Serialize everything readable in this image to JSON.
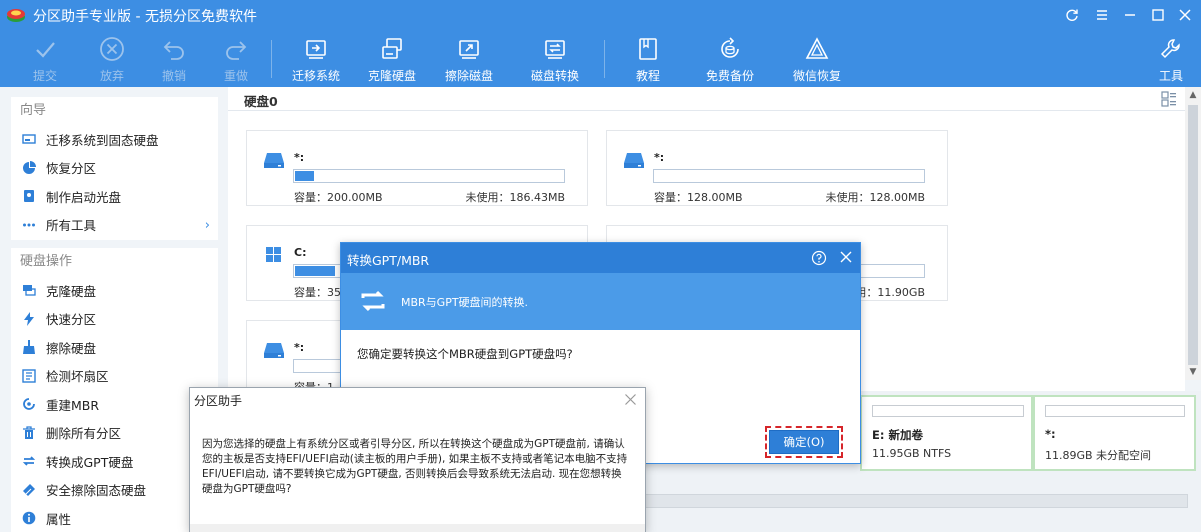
{
  "app": {
    "title": "分区助手专业版 - 无损分区免费软件"
  },
  "window_controls": [
    "refresh-icon",
    "menu-icon",
    "minimize-icon",
    "maximize-icon",
    "close-icon"
  ],
  "toolbar": {
    "submit": "提交",
    "discard": "放弃",
    "undo": "撤销",
    "redo": "重做",
    "migrate": "迁移系统",
    "clone": "克隆硬盘",
    "wipe": "擦除磁盘",
    "convert": "磁盘转换",
    "tutorial": "教程",
    "backup": "免费备份",
    "wechat": "微信恢复",
    "tools": "工具"
  },
  "sidebar": {
    "guide_heading": "向导",
    "guide_items": [
      {
        "label": "迁移系统到固态硬盘",
        "icon": "migrate-ssd-icon"
      },
      {
        "label": "恢复分区",
        "icon": "recover-partition-icon"
      },
      {
        "label": "制作启动光盘",
        "icon": "boot-disc-icon"
      },
      {
        "label": "所有工具",
        "icon": "more-icon"
      }
    ],
    "disk_heading": "硬盘操作",
    "disk_items": [
      {
        "label": "克隆硬盘",
        "icon": "clone-disk-icon"
      },
      {
        "label": "快速分区",
        "icon": "lightning-icon"
      },
      {
        "label": "擦除硬盘",
        "icon": "brush-icon"
      },
      {
        "label": "检测坏扇区",
        "icon": "check-sector-icon"
      },
      {
        "label": "重建MBR",
        "icon": "rebuild-mbr-icon"
      },
      {
        "label": "删除所有分区",
        "icon": "trash-icon"
      },
      {
        "label": "转换成GPT硬盘",
        "icon": "convert-icon"
      },
      {
        "label": "安全擦除固态硬盘",
        "icon": "erase-ssd-icon"
      },
      {
        "label": "属性",
        "icon": "info-icon"
      }
    ]
  },
  "disk": {
    "title": "硬盘0",
    "cards": [
      {
        "name": "*:",
        "capacity": "容量：200.00MB",
        "free": "未使用：186.43MB",
        "fill": 0.07
      },
      {
        "name": "*:",
        "capacity": "容量：128.00MB",
        "free": "未使用：128.00MB",
        "fill": 0.0
      },
      {
        "name": "C:",
        "capacity": "容量：35.",
        "free": "",
        "fill": 0.15
      },
      {
        "name": "",
        "capacity": "",
        "free": "未使用：11.90GB",
        "fill": 0.0
      },
      {
        "name": "*:",
        "capacity": "容量：1",
        "free": "",
        "fill": 0.0
      }
    ]
  },
  "partitions": [
    {
      "name": "E: 新加卷",
      "detail": "11.95GB NTFS"
    },
    {
      "name": "*:",
      "detail": "11.89GB 未分配空间"
    }
  ],
  "convert_dialog": {
    "title": "转换GPT/MBR",
    "banner": "MBR与GPT硬盘间的转换.",
    "question": "您确定要转换这个MBR硬盘到GPT硬盘吗?",
    "ok": "确定(O)"
  },
  "warning_dialog": {
    "title": "分区助手",
    "message": "因为您选择的硬盘上有系统分区或者引导分区, 所以在转换这个硬盘成为GPT硬盘前, 请确认您的主板是否支持EFI/UEFI启动(读主板的用户手册), 如果主板不支持或者笔记本电脑不支持EFI/UEFI启动, 请不要转换它成为GPT硬盘, 否则转换后会导致系统无法启动. 现在您想转换硬盘为GPT硬盘吗?"
  },
  "colors": {
    "accent": "#3d8ee3",
    "dialog_title": "#2e7fd7",
    "highlight_border": "#d6252a",
    "partition_border": "#bfe3bf"
  }
}
